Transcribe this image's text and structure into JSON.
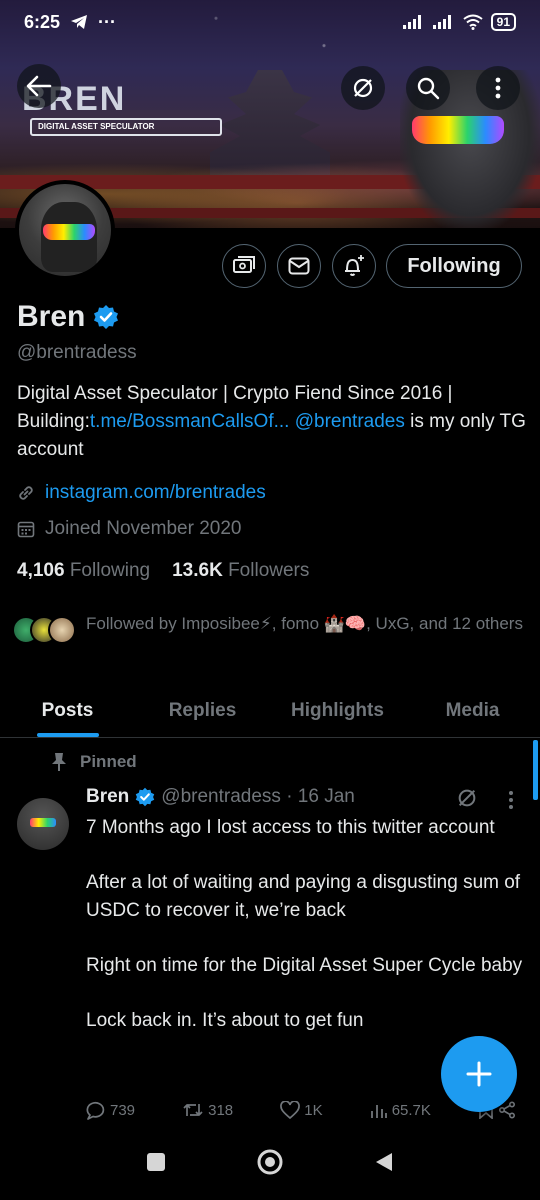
{
  "status_bar": {
    "time": "6:25",
    "battery": "91"
  },
  "profile": {
    "name": "Bren",
    "handle": "@brentradess",
    "banner_logo": "BREN",
    "banner_tagline": "DIGITAL ASSET SPECULATOR",
    "bio_text_1": "Digital Asset Speculator | Crypto Fiend Since 2016 | Building:",
    "bio_link": "t.me/BossmanCallsOf...",
    "bio_mention": "@brentrades",
    "bio_text_2": " is my only TG account",
    "website": "instagram.com/brentrades",
    "joined": "Joined November 2020",
    "following_count": "4,106",
    "following_label": "Following",
    "followers_count": "13.6K",
    "followers_label": "Followers",
    "followed_by": "Followed by Imposibee⚡, fomo 🏰🧠, UxG, and 12 others",
    "follow_button": "Following"
  },
  "tabs": [
    "Posts",
    "Replies",
    "Highlights",
    "Media"
  ],
  "tweet": {
    "pinned_label": "Pinned",
    "author_name": "Bren",
    "author_handle": "@brentradess · 16 Jan",
    "paragraphs": [
      "7 Months ago I lost access to this twitter account",
      "After a lot of waiting and paying a disgusting sum of USDC to recover it, we’re back",
      "Right on time for the Digital Asset Super Cycle baby",
      "Lock back in. It’s about to get fun"
    ],
    "replies": "739",
    "retweets": "318",
    "likes": "1K",
    "views": "65.7K"
  },
  "colors": {
    "accent": "#1d9bf0",
    "muted": "#71767b",
    "text": "#e7e9ea",
    "background": "#000000"
  }
}
